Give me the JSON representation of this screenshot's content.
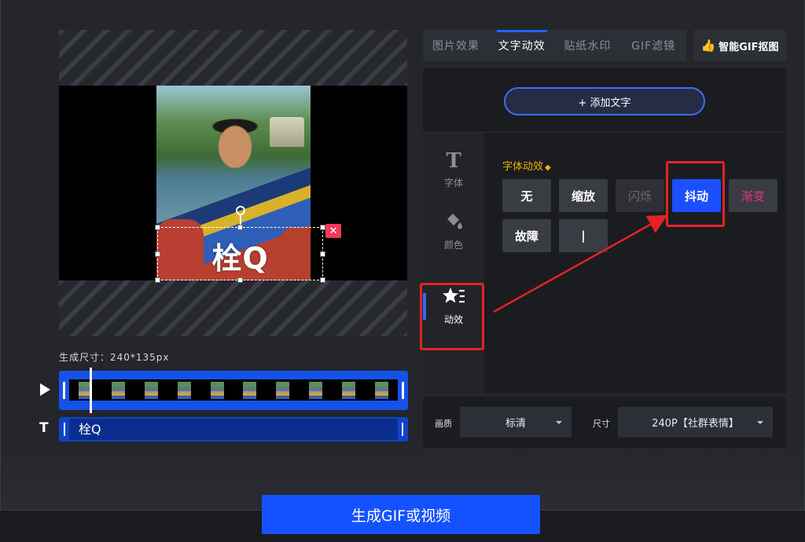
{
  "preview": {
    "overlay_text": "栓Q",
    "delete_symbol": "✕",
    "size_label": "生成尺寸：240*135px"
  },
  "timeline": {
    "text_track_label": "栓Q",
    "text_track_icon": "T"
  },
  "tabs": [
    {
      "label": "图片效果",
      "active": false
    },
    {
      "label": "文字动效",
      "active": true
    },
    {
      "label": "贴纸水印",
      "active": false
    },
    {
      "label": "GIF滤镜",
      "active": false
    }
  ],
  "smart_button": {
    "label": "智能GIF抠图",
    "icon": "thumbs-up-icon"
  },
  "add_text_button": "+ 添加文字",
  "side_nav": [
    {
      "label": "字体",
      "icon": "T"
    },
    {
      "label": "颜色",
      "icon": "paint-bucket-icon"
    },
    {
      "label": "动效",
      "icon": "star-list-icon"
    }
  ],
  "effects": {
    "title": "字体动效",
    "items": [
      {
        "label": "无",
        "state": "normal"
      },
      {
        "label": "缩放",
        "state": "normal"
      },
      {
        "label": "闪烁",
        "state": "disabled"
      },
      {
        "label": "抖动",
        "state": "active"
      },
      {
        "label": "渐变",
        "state": "pink"
      },
      {
        "label": "故障",
        "state": "normal"
      },
      {
        "label": "|",
        "state": "normal"
      }
    ]
  },
  "settings": {
    "quality_label": "画质",
    "quality_value": "标清",
    "size_label": "尺寸",
    "size_value": "240P【社群表情】"
  },
  "generate_button": "生成GIF或视频",
  "colors": {
    "accent": "#1552ff",
    "highlight_red": "#e02424",
    "effect_title": "#f0b400",
    "pink_text": "#e0368a"
  }
}
